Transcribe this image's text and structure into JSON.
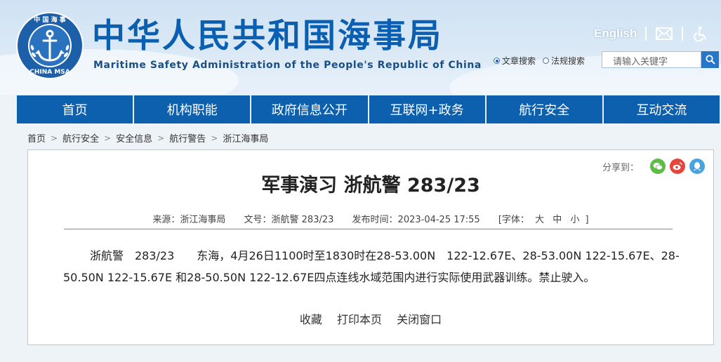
{
  "header": {
    "title_cn": "中华人民共和国海事局",
    "title_en": "Maritime Safety Administration of the People's Republic of China",
    "logo_top_text": "中国海事",
    "logo_bottom_text": "CHINA MSA",
    "english_link": "English",
    "mail_icon": "mail-icon",
    "accessibility_icon": "accessibility-icon"
  },
  "search": {
    "options": [
      "文章搜索",
      "法规搜索"
    ],
    "selected": "文章搜索",
    "placeholder": "请输入关键字",
    "button_icon": "search-icon"
  },
  "nav": {
    "items": [
      "首页",
      "机构职能",
      "政府信息公开",
      "互联网+政务",
      "航行安全",
      "互动交流"
    ]
  },
  "breadcrumb": [
    "首页",
    "航行安全",
    "安全信息",
    "航行警告",
    "浙江海事局"
  ],
  "article": {
    "share_label": "分享到：",
    "share_icons": [
      "wechat-icon",
      "weibo-icon",
      "qq-icon"
    ],
    "title": "军事演习 浙航警 283/23",
    "source": "来源：浙江海事局",
    "doc_no": "文号：浙航警 283/23",
    "published": "发布时间：2023-04-25 17:55",
    "font_label": "[字体：",
    "font_sizes": [
      "大",
      "中",
      "小"
    ],
    "font_close": "]",
    "body": "浙航警　283/23　　东海，4月26日1100时至1830时在28-53.00N　122-12.67E、28-53.00N 122-15.67E、28-50.50N 122-15.67E 和28-50.50N 122-12.67E四点连线水域范围内进行实际使用武器训练。禁止驶入。",
    "actions": [
      "收藏",
      "打印本页",
      "关闭窗口"
    ]
  },
  "colors": {
    "brand_blue": "#0d60ad",
    "title_blue": "#0b5fb0",
    "wechat": "#5dbb46",
    "weibo": "#e6453b",
    "qq": "#4aa3df"
  }
}
